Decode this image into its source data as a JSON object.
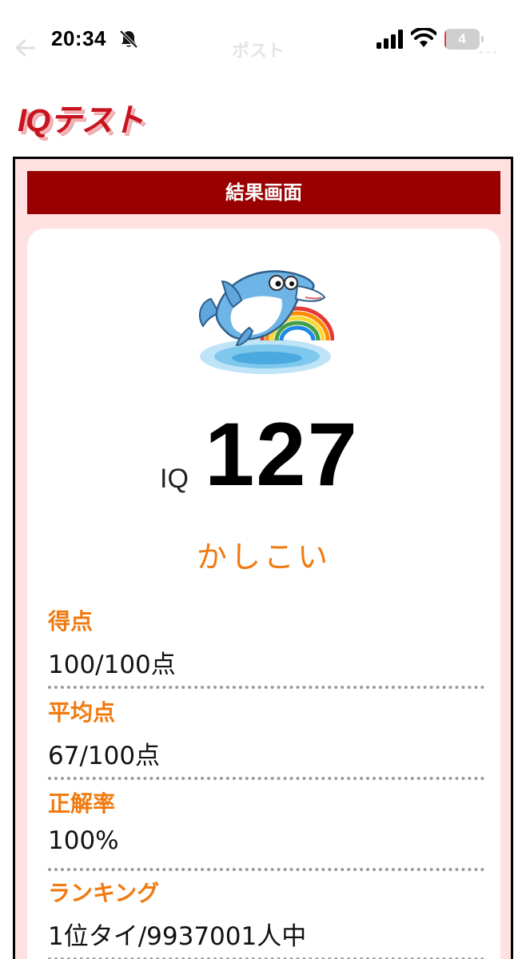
{
  "status_bar": {
    "time": "20:34",
    "battery_level": "4",
    "battery_fraction": 0.04,
    "ghost_title": "ポスト",
    "ghost_more": "..."
  },
  "logo": {
    "text": "IQテスト"
  },
  "result": {
    "header": "結果画面",
    "iq_label": "IQ",
    "iq_value": "127",
    "rating": "かしこい",
    "stats": [
      {
        "label": "得点",
        "value": "100/100点"
      },
      {
        "label": "平均点",
        "value": "67/100点"
      },
      {
        "label": "正解率",
        "value": "100%"
      },
      {
        "label": "ランキング",
        "value": "1位タイ/9937001人中"
      }
    ]
  },
  "colors": {
    "header_bg": "#990000",
    "panel_bg": "#ffe1e1",
    "accent_orange": "#f07a10",
    "logo_red": "#c8141e"
  },
  "icons": [
    "bell-muted-icon",
    "signal-icon",
    "wifi-icon",
    "battery-icon",
    "back-arrow-icon",
    "dolphin-mascot"
  ]
}
